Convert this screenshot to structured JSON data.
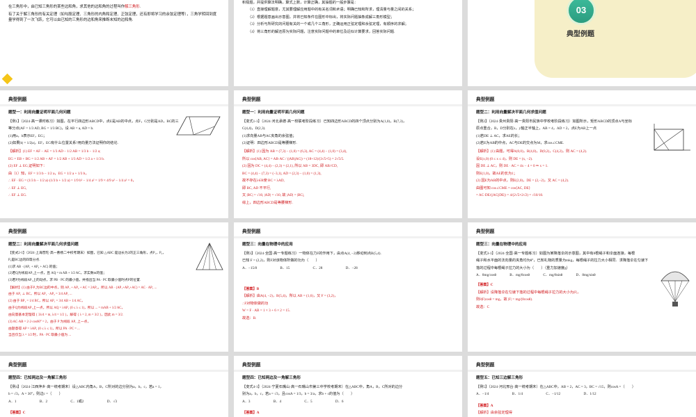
{
  "slides": {
    "s1": {
      "paragraphs": [
        "在三角形中，由已知三角形的某些边和角，求其他的边和角的过程叫作解三角形.",
        "有了关于解三角形的有关定理（如勾股定理、三角形的内角和定理、正弦定理，还有即将学习的余弦定理等），三角学转回到度量学得到了一次飞跃，它可以由已知的三角形的边和角来推断未知的边和角."
      ],
      "highlight": "解三角形"
    },
    "s2": {
      "intro": "积极题，并提供算法明确，算式上数，计算正确，其操题的一般步骤是：",
      "steps": [
        "（1）直接理解题意，尤其要理解应用题中的有关名词和术语；明确已知和所求，理清量与量之间的关系；",
        "（2）根据题意画出示意图，并将已知条件在图形中标出，将实际问题抽象成解三角形模型；",
        "（3）分析与所研究的问题有关的一个或几个三角形，正确运用正弦定理和余弦定理，有顺序的求解；",
        "（4）将三角形的解还原为实际问题，注意实际问题中的单位及近似计算要求，回答实际问题."
      ]
    },
    "s3": {
      "number": "03",
      "title": "典型例题"
    },
    "s4": {
      "header": "典型例题",
      "subtitle": "题型一：利用向量证明平面几何问题",
      "lines": [
        "【例1】（2024·高一课时练习）如图，在平行四边形ABCD中，点E是AB的中点，点F，G分别是AD，BC的三",
        "等分点(AF = 1/3 AD, BG = 1/3 BC)，设 AB = a, AD = b.",
        "(1)用a，b表示EF，EG；",
        "(2)如果|b| = 1/2|a|，EF，EG有什么位置关系?用向量方法证明你的结论."
      ],
      "answer": [
        "【解析】(1) EF = AF − AE = 1/3 AD − 1/2 AB = 1/3 b − 1/2 a;",
        "EG = EB + BG = 1/2 AB + AF = 1/2 AB + 1/3 AD = 1/2 a + 1/3 b.",
        "(2) EF ⊥ EG,证明如下：",
        "由（1）知，EF = 1/3 b − 1/2 a，EG = 1/2 a + 1/3 b，",
        "∴ EF · EG = (1/3 b − 1/2 a)·(1/3 b + 1/2 a) = 1/9 b² − 1/4 a² = 1/9 × 4/9 a² − 1/4 a² = 0，",
        "∴ EF ⊥ EG,",
        "∴ EF ⊥ EG."
      ]
    },
    "s5": {
      "header": "典型例题",
      "subtitle": "题型一：利用向量证明平面几何问题",
      "lines": [
        "【变式1-1】（2024·河北承德·高一校联考阶段练习）已知四边形ABCD的四个顶点分别为A(1,0)，B(7,3)，",
        "C(4,4)，D(2,3).",
        "(1)求向量AB与AC夹角的余弦值；",
        "(2)证明：四边形ABCD是等腰梯形."
      ],
      "answer": [
        "【解析】(1) 因为 AB = (7,3) − (1,0) = (6,3), AC = (4,4) − (1,0) = (3,4),",
        "所以 cos⟨AB, AC⟩ = AB·AC / (|AB||AC|) = (18+12)/(3√5×5) = 2√5/5.",
        "(2) 因为 DC = (4,4) − (2,3) = (2,1), 所以 AB = 3DC, 即 AB//CD,",
        "BC = (4,4) − (7,3) = (−3,1), AD = (2,3) − (1,0) = (1,3),",
        "故不存在λ∈R使 BC = λAD,",
        "即 BC, AD 不平行,",
        "又 |BC| = √10, |AD| = √10, 故 |AD| = |BC|,",
        "综上，四边形ABCD是等腰梯形."
      ]
    },
    "s6": {
      "header": "典型例题",
      "subtitle": "题型二：利用向量解决平面几何求值问题",
      "lines": [
        "【例2】（2024·贵州贵阳·高一贵阳市民族中学校考阶段练习）如图所示，矩形ABCD的顶点A与坐标",
        "原点重合，B，D分别在x，y轴正半轴上，AB = 4，AD = 2，点E为AB上一点",
        "(1)若DE ⊥ AC，求AE的长；",
        "(2)若E为AB的中点，AC与DE的交点为M，求cos∠CME."
      ],
      "answer": [
        "【解析】(1) 由题，可得A(0,0)，B(4,0)，D(0,2)，C(4,2)，则 AC = (4,2).",
        "设E(x,0) (0 ≤ x ≤ 4)，则 DE = (x, −2).",
        "因 DE ⊥ AC，则 DE · AC = 4x − 4 = 0 ⇒ x = 1.",
        "则E(1,0)，故AE的长为1；",
        "(2) 因E为AB的中点，则E(2,0)，DE = (2,−2)，又 AC = (4,2).",
        "由图可知 cos∠CME = cos⟨AC, DE⟩",
        "= AC·DE/(|AC||DE|) = 4/(2√5×2√2) = √10/10."
      ]
    },
    "s7": {
      "header": "典型例题",
      "subtitle": "题型二：利用向量解决平面几何求值问题",
      "lines": [
        "【变式2-1】（2024·上海普陀·高一曹杨二中校考期末）如图，已知 △ABC 是边长为2的正三角形，点P₁，P₂，",
        "P₃是BC边的四等分点.",
        "(1)求 AB · (AP₁ + AP₂ + AC) 的值；",
        "(2)若Q为线段AP₁上一点，且 AQ = m AB + 1/2 AC，求实数m的值；",
        "(3)若P为线段AP₁上的动点，求 PB · PC 的最小值，并指出当 PA · PC 取最小值时点P的位置."
      ],
      "answer": [
        "【解析】(1) 由于P₁为BC边的中点，则 AP₁ + AP₂ + AC = 2AP₂，所以 AB · (AP₁+AP₂+AC) = AC · AP₁ ...",
        "由于 AP₁ ⊥ BC，所以 AP₁ · AP₂ = 3/4 AP₁ ...",
        "(2) 由于 BP₁ = 1/4 BC，所以 AP₁ = 3/4 AB + 1/4 AC，",
        "由于Q为线段AP₁上一点，所以 AQ = λAP₁ (0 ≤ λ ≤ 1)，所以 ... = mAB + 1/2 AC，",
        "由向量基本定理得 { 3λ/4 = m, λ/4 = 1/2 }，解得 { λ = 2, m = 3/2 }，因此 m = 3/2.",
        "(3) AC·AB = 2·2·cos60° = 2，由于 P 为线段 AP₁ 上一点，",
        "由题意得 AP = λAP₁ (0 ≤ λ ≤ 1)，所以 PA · PC = ...",
        "当且仅当 λ = 1/2 时，PA · PC 取最小值为 ..."
      ]
    },
    "s8": {
      "header": "典型例题",
      "subtitle": "题型三：向量在物理中的应用",
      "lines": [
        "【例3】（2024·全国·高一专题练习）一物体在力F的作用下，由点A(4, −2)移动到点B(5,4).",
        "已知 F = (2,2)，则F对该物体所做的功为（　　）"
      ],
      "options": [
        "A．−15/8",
        "B．15",
        "C．28",
        "D．−28"
      ],
      "answer_label": "【答案】B",
      "answer": [
        "【解析】由A(4, −2)，B(5,4)，所以 AB = (1,6)，又 F = (3,2)，",
        "∴F对物体做的功",
        "W = F · AB = 1 × 3 + 6 × 2 = 15.",
        "故选：B."
      ]
    },
    "s9": {
      "header": "典型例题",
      "subtitle": "题型三：向量在物理中的应用",
      "lines": [
        "【变式3-1】（2024·全国·高一专题练习）如图为某降落伞的示意图，其中有8根绳子和伞面连接，每根",
        "绳子和水平面的法向量的夹角均为θ°，已知礼物的质量为mkg，每根绳子的拉力大小相同．求降落伞在匀速下",
        "落的过程中每根绳子拉力的大小为（　　）（重力加速度g）"
      ],
      "options": [
        "A．8mg/cosθ",
        "B．mg/8cosθ",
        "C．mg/8sinθ",
        "D．8mg/sinθ"
      ],
      "answer_label": "【答案】C",
      "answer": [
        "【解析】设降落伞在匀速下落的过程中每根绳子拉力的大小为|F|，",
        "则8|F|cosθ = mg，故 |F| = mg/(8cosθ).",
        "故选：C"
      ]
    },
    "s10": {
      "header": "典型例题",
      "subtitle": "题型四：已知两边及一角解三角形",
      "lines": [
        "【例4】（2024·江西萍乡·高一统考期末）设△ABC内角A，B，C所对的边分别为a，b，c，若a = 1，",
        "b = √3，A = 30°，则边c =（　　）"
      ],
      "options": [
        "A．1",
        "B．2",
        "C．1或2",
        "D．√3"
      ],
      "answer_label": "【答案】C"
    },
    "s11": {
      "header": "典型例题",
      "subtitle": "题型四：已知两边及一角解三角形",
      "lines": [
        "【变式4-1】（2024·宁夏石嘴山·高一石嘴山市第三中学校考期末）在△ABC中，角A，B，C所对的边分",
        "别为a，b，c，若a = √3，且cosA = 1/3，b = 3/a，求b + c的值为（　　）"
      ],
      "options": [
        "A．3",
        "B．4",
        "C．5",
        "D．6"
      ],
      "answer_label": "【答案】A"
    },
    "s12": {
      "header": "典型例题",
      "subtitle": "题型五：已知三边解三角形",
      "lines": [
        "【例5】（2024·河北邢台·高一统考期末）在△ABC中，AB = 2，AC = 3，BC = √15，则cosA =（　　）"
      ],
      "options": [
        "A．−1/4",
        "B．1/4",
        "C．−1/12",
        "D．1/12"
      ],
      "answer_label": "【答案】A",
      "answer": [
        "【解析】由余弦定理得"
      ]
    }
  },
  "colors": {
    "red": "#d0191d",
    "diamond": "#f5c518",
    "teal": "#2b9c7f",
    "card": "#f6efc8"
  },
  "icons": [
    "diamond-icon",
    "parallelogram-figure",
    "rectangle-figure",
    "triangle-figure",
    "parachute-figure"
  ]
}
